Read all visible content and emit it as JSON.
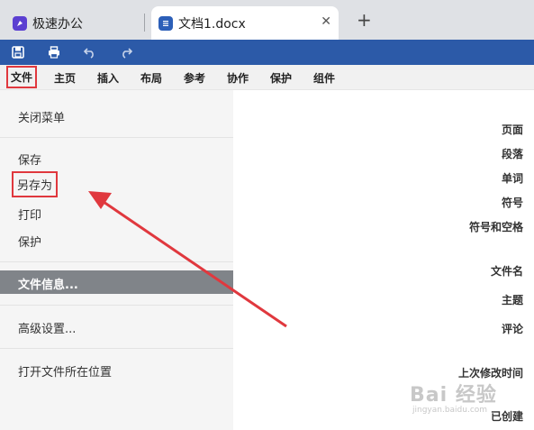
{
  "tabs": {
    "inactive": {
      "label": "极速办公",
      "icon": "rocket-icon"
    },
    "active": {
      "label": "文档1.docx",
      "icon": "document-icon",
      "close": "✕"
    },
    "new_tab": "+"
  },
  "toolbar": {
    "buttons": [
      "save-icon",
      "print-icon",
      "undo-icon",
      "redo-icon"
    ]
  },
  "menu": {
    "items": [
      "文件",
      "主页",
      "插入",
      "布局",
      "参考",
      "协作",
      "保护",
      "组件"
    ]
  },
  "left_panel": {
    "close_menu": "关闭菜单",
    "save": "保存",
    "save_as": "另存为",
    "print": "打印",
    "protect": "保护",
    "file_info": "文件信息...",
    "advanced": "高级设置...",
    "open_location": "打开文件所在位置"
  },
  "right_panel": {
    "labels": [
      "页面",
      "段落",
      "单词",
      "符号",
      "符号和空格",
      "文件名",
      "主题",
      "评论",
      "上次修改时间",
      "已创建"
    ]
  },
  "watermark": {
    "main": "Bai 经验",
    "sub": "jingyan.baidu.com"
  },
  "colors": {
    "toolbar": "#2c5aa8",
    "annotation": "#e0383e",
    "selected_item": "#808489"
  }
}
